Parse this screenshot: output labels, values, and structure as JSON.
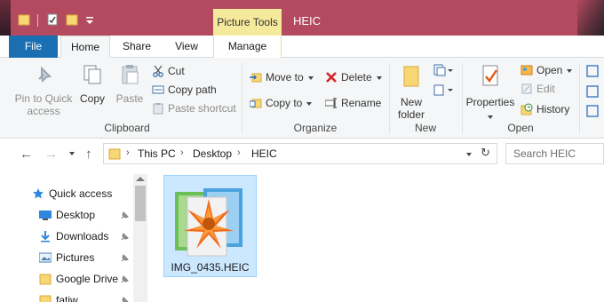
{
  "window": {
    "title": "HEIC",
    "context_tab_group": "Picture Tools"
  },
  "tabs": {
    "file": "File",
    "home": "Home",
    "share": "Share",
    "view": "View",
    "manage": "Manage"
  },
  "ribbon": {
    "clipboard": {
      "label": "Clipboard",
      "pin_line1": "Pin to Quick",
      "pin_line2": "access",
      "copy": "Copy",
      "paste": "Paste",
      "cut": "Cut",
      "copy_path": "Copy path",
      "paste_shortcut": "Paste shortcut"
    },
    "organize": {
      "label": "Organize",
      "move_to": "Move to",
      "copy_to": "Copy to",
      "delete": "Delete",
      "rename": "Rename"
    },
    "new": {
      "label": "New",
      "new_folder_line1": "New",
      "new_folder_line2": "folder"
    },
    "open": {
      "label": "Open",
      "properties": "Properties",
      "open": "Open",
      "edit": "Edit",
      "history": "History"
    }
  },
  "address": {
    "crumbs": [
      "This PC",
      "Desktop",
      "HEIC"
    ],
    "search_placeholder": "Search HEIC"
  },
  "sidebar": {
    "items": [
      {
        "label": "Quick access"
      },
      {
        "label": "Desktop"
      },
      {
        "label": "Downloads"
      },
      {
        "label": "Pictures"
      },
      {
        "label": "Google Drive"
      },
      {
        "label": "fatiw"
      }
    ]
  },
  "files": [
    {
      "name": "IMG_0435.HEIC"
    }
  ],
  "colors": {
    "titlebar": "#b34a5f",
    "file_tab": "#1a6fb3",
    "picture_tools": "#f5e99b",
    "selection": "#cce8ff"
  }
}
